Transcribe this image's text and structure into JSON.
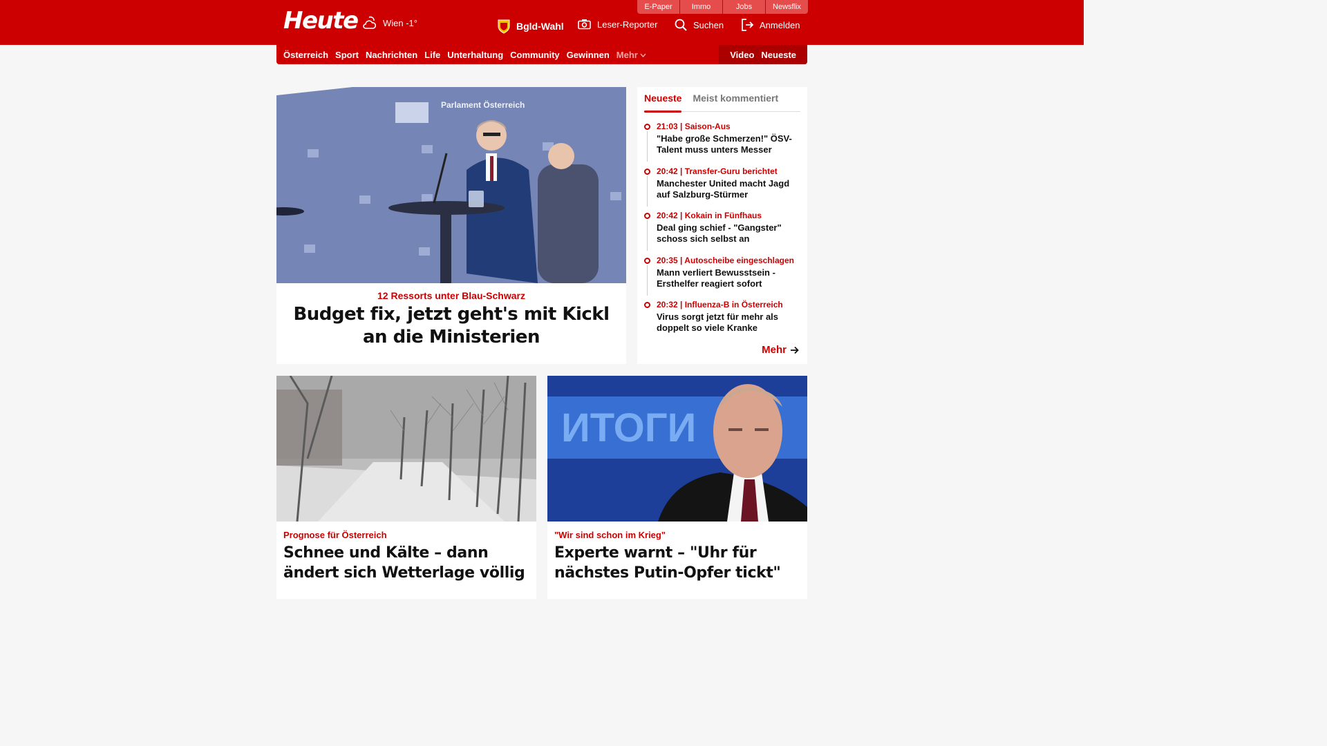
{
  "header": {
    "logo": "Heute",
    "weather": "Wien -1°",
    "top_links": [
      "E-Paper",
      "Immo",
      "Jobs",
      "Newsflix"
    ],
    "election": "Bgld-Wahl",
    "reporter": "Leser-Reporter",
    "search": "Suchen",
    "login": "Anmelden"
  },
  "nav": {
    "items": [
      "Österreich",
      "Sport",
      "Nachrichten",
      "Life",
      "Unterhaltung",
      "Community",
      "Gewinnen"
    ],
    "more": "Mehr",
    "right": [
      "Video",
      "Neueste"
    ]
  },
  "hero": {
    "image_text": "Parlament Österreich",
    "kicker": "12 Ressorts unter Blau-Schwarz",
    "title": "Budget fix, jetzt geht's mit Kickl an die Ministerien"
  },
  "side": {
    "tabs": [
      "Neueste",
      "Meist kommentiert"
    ],
    "items": [
      {
        "meta": "21:03 | Saison-Aus",
        "title": "\"Habe große Schmerzen!\" ÖSV-Talent muss unters Messer"
      },
      {
        "meta": "20:42 | Transfer-Guru berichtet",
        "title": "Manchester United macht Jagd auf Salzburg-Stürmer"
      },
      {
        "meta": "20:42 | Kokain in Fünfhaus",
        "title": "Deal ging schief - \"Gangster\" schoss sich selbst an"
      },
      {
        "meta": "20:35 | Autoscheibe eingeschlagen",
        "title": "Mann verliert Bewusstsein - Ersthelfer reagiert sofort"
      },
      {
        "meta": "20:32 | Influenza-B in Österreich",
        "title": "Virus sorgt jetzt für mehr als doppelt so viele Kranke"
      }
    ],
    "more": "Mehr"
  },
  "cards": [
    {
      "kicker": "Prognose für Österreich",
      "title": "Schnee und Kälte – dann ändert sich Wetterlage völlig"
    },
    {
      "kicker": "\"Wir sind schon im Krieg\"",
      "image_text": "ИТОГИ",
      "title": "Experte warnt – \"Uhr für nächstes Putin-Opfer tickt\""
    }
  ]
}
